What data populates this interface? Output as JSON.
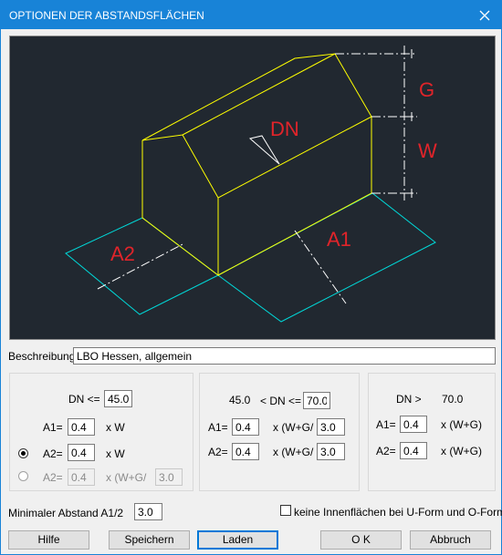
{
  "window": {
    "title": "OPTIONEN DER ABSTANDSFLÄCHEN"
  },
  "preview": {
    "labels": {
      "dn": "DN",
      "g": "G",
      "w": "W",
      "a1": "A1",
      "a2": "A2"
    }
  },
  "beschreibung": {
    "label": "Beschreibung",
    "value": "LBO Hessen, allgemein"
  },
  "group1": {
    "dn_label": "DN <=",
    "dn_value": "45.0",
    "a1_label": "A1=",
    "a1_value": "0.4",
    "a1_unit": "x W",
    "a2_label": "A2=",
    "a2_value": "0.4",
    "a2_unit": "x W",
    "a2b_label": "A2=",
    "a2b_value": "0.4",
    "a2b_unit": "x (W+G/",
    "a2b_value2": "3.0",
    "radio_a2_checked": true
  },
  "group2": {
    "dn_low": "45.0",
    "dn_label": "< DN <=",
    "dn_value": "70.0",
    "a1_label": "A1=",
    "a1_value": "0.4",
    "a1_unit": "x (W+G/",
    "a1_value2": "3.0",
    "a2_label": "A2=",
    "a2_value": "0.4",
    "a2_unit": "x (W+G/",
    "a2_value2": "3.0"
  },
  "group3": {
    "dn_label": "DN >",
    "dn_value": "70.0",
    "a1_label": "A1=",
    "a1_value": "0.4",
    "a1_unit": "x (W+G)",
    "a2_label": "A2=",
    "a2_value": "0.4",
    "a2_unit": "x (W+G)"
  },
  "min_abstand": {
    "label": "Minimaler Abstand A1/2",
    "value": "3.0"
  },
  "checkbox_inner": {
    "label": "keine Innenflächen bei U-Form und O-Form",
    "checked": false
  },
  "buttons": {
    "help": "Hilfe",
    "save": "Speichern",
    "load": "Laden",
    "ok": "O K",
    "cancel": "Abbruch"
  },
  "colors": {
    "titlebar": "#1883d7",
    "preview_bg": "#212830",
    "building": "#ffff00",
    "ground": "#00d8d8",
    "dimension": "#ffffff",
    "label_red": "#e0242a"
  }
}
